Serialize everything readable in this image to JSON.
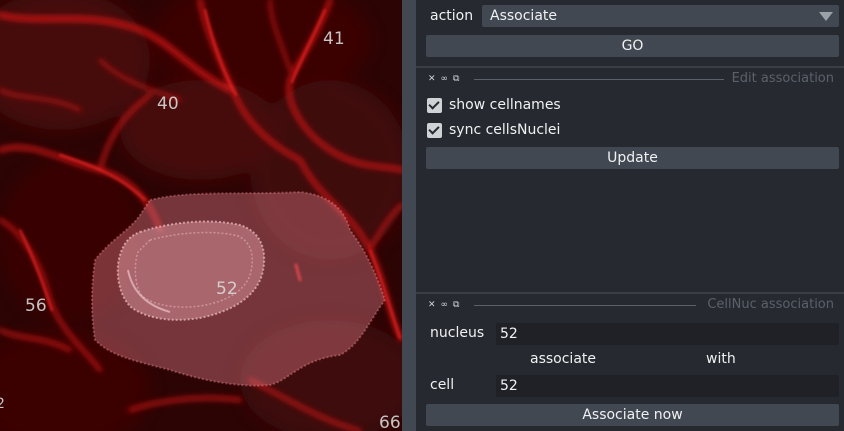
{
  "canvas": {
    "cell_labels": [
      "41",
      "40",
      "52",
      "56",
      "66",
      "2"
    ]
  },
  "panel": {
    "action_label": "action",
    "action_select": {
      "selected": "Associate"
    },
    "go_button": "GO",
    "edit_association": {
      "title": "Edit association",
      "show_cellnames_label": "show cellnames",
      "show_cellnames_checked": true,
      "sync_cellsnuclei_label": "sync cellsNuclei",
      "sync_cellsnuclei_checked": true,
      "update_button": "Update"
    },
    "cellnuc_association": {
      "title": "CellNuc association",
      "nucleus_label": "nucleus",
      "nucleus_value": "52",
      "associate_text": "associate",
      "with_text": "with",
      "cell_label": "cell",
      "cell_value": "52",
      "associate_now_button": "Associate now"
    },
    "dock_icons": {
      "close": "close-icon",
      "float": "float-icon",
      "pin": "pin-icon"
    }
  }
}
